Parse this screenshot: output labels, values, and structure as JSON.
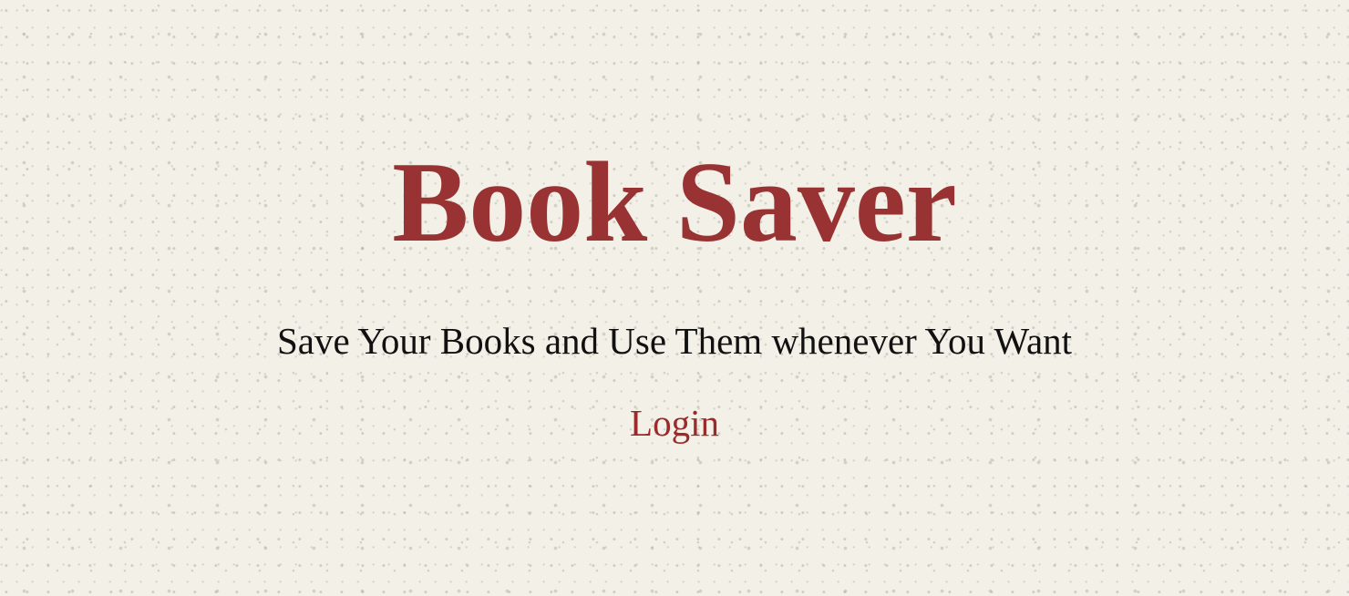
{
  "header": {
    "title": "Book Saver"
  },
  "hero": {
    "subtitle": "Save Your Books and Use Them whenever You Want",
    "login_label": "Login"
  },
  "colors": {
    "accent": "#993333",
    "background": "#f3f0e8",
    "text": "#111111"
  }
}
